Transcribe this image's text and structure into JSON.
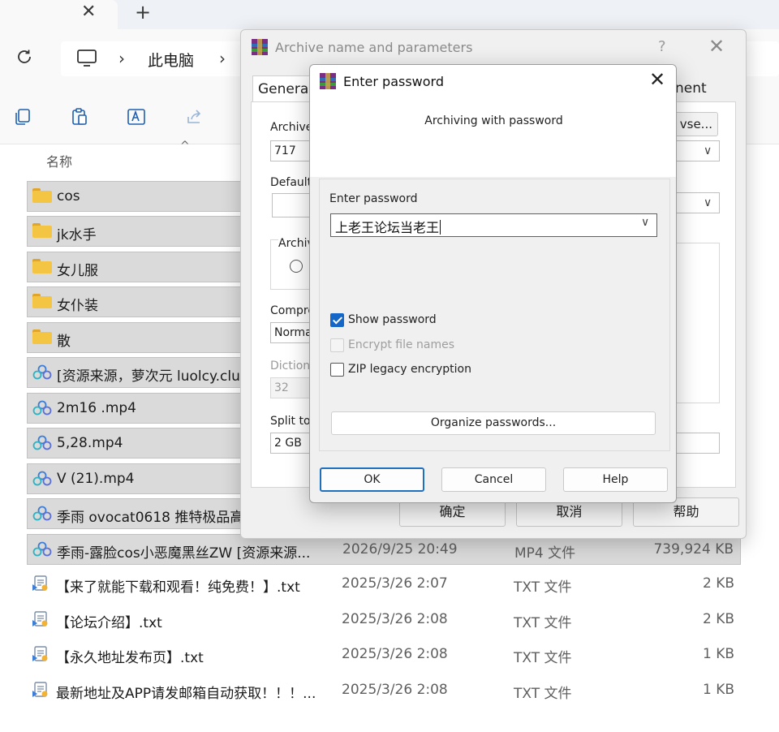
{
  "explorer": {
    "tab_close": "✕",
    "tab_new": "+",
    "breadcrumb": {
      "separator": "›",
      "items": [
        "此电脑"
      ]
    },
    "column_header": "名称",
    "files": [
      {
        "name": "cos",
        "kind": "folder",
        "date": "",
        "type": "",
        "size": "",
        "selected": true
      },
      {
        "name": "jk水手",
        "kind": "folder",
        "date": "",
        "type": "",
        "size": "",
        "selected": true
      },
      {
        "name": "女儿服",
        "kind": "folder",
        "date": "",
        "type": "",
        "size": "",
        "selected": true
      },
      {
        "name": "女仆装",
        "kind": "folder",
        "date": "",
        "type": "",
        "size": "",
        "selected": true
      },
      {
        "name": "散",
        "kind": "folder",
        "date": "",
        "type": "",
        "size": "",
        "selected": true
      },
      {
        "name": "[资源来源，萝次元 luolcy.clu",
        "kind": "video",
        "date": "",
        "type": "",
        "size": "",
        "selected": true
      },
      {
        "name": "2m16 .mp4",
        "kind": "video",
        "date": "",
        "type": "",
        "size": "",
        "selected": true
      },
      {
        "name": "5,28.mp4",
        "kind": "video",
        "date": "",
        "type": "",
        "size": "",
        "selected": true
      },
      {
        "name": "V (21).mp4",
        "kind": "video",
        "date": "",
        "type": "",
        "size": "",
        "selected": true
      },
      {
        "name": "季雨 ovocat0618 推特极品高",
        "kind": "video",
        "date": "",
        "type": "",
        "size": "",
        "selected": true
      },
      {
        "name": "季雨-露脸cos小恶魔黑丝ZW [资源来源...",
        "kind": "video",
        "date": "2026/9/25 20:49",
        "type": "MP4 文件",
        "size": "739,924 KB",
        "selected": true
      },
      {
        "name": "【来了就能下载和观看！纯免费！】.txt",
        "kind": "text",
        "date": "2025/3/26 2:07",
        "type": "TXT 文件",
        "size": "2 KB",
        "selected": false
      },
      {
        "name": "【论坛介绍】.txt",
        "kind": "text",
        "date": "2025/3/26 2:08",
        "type": "TXT 文件",
        "size": "2 KB",
        "selected": false
      },
      {
        "name": "【永久地址发布页】.txt",
        "kind": "text",
        "date": "2025/3/26 2:08",
        "type": "TXT 文件",
        "size": "1 KB",
        "selected": false
      },
      {
        "name": "最新地址及APP请发邮箱自动获取！！！...",
        "kind": "text",
        "date": "2025/3/26 2:08",
        "type": "TXT 文件",
        "size": "1 KB",
        "selected": false
      }
    ]
  },
  "archive_dialog": {
    "title": "Archive name and parameters",
    "help": "?",
    "close": "✕",
    "tab_general": "General",
    "tab_right_fragment": "nent",
    "archive_label": "Archive",
    "archive_value": "717",
    "browse_fragment": "vse...",
    "default_label": "Default",
    "archive_group_label": "Archiv",
    "compression_label": "Compre",
    "compression_value": "Norma",
    "dictionary_label": "Dictiona",
    "dictionary_value": "32",
    "split_label": "Split to",
    "split_value": "2 GB",
    "ok": "确定",
    "cancel": "取消",
    "help_btn": "帮助"
  },
  "password_dialog": {
    "title": "Enter password",
    "close": "✕",
    "subtitle": "Archiving with password",
    "enter_label": "Enter password",
    "password_value": "上老王论坛当老王",
    "show_password": {
      "label": "Show password",
      "checked": true,
      "enabled": true
    },
    "encrypt_names": {
      "label": "Encrypt file names",
      "checked": false,
      "enabled": false
    },
    "zip_legacy": {
      "label": "ZIP legacy encryption",
      "checked": false,
      "enabled": true
    },
    "organize": "Organize passwords...",
    "ok": "OK",
    "cancel": "Cancel",
    "help": "Help"
  }
}
